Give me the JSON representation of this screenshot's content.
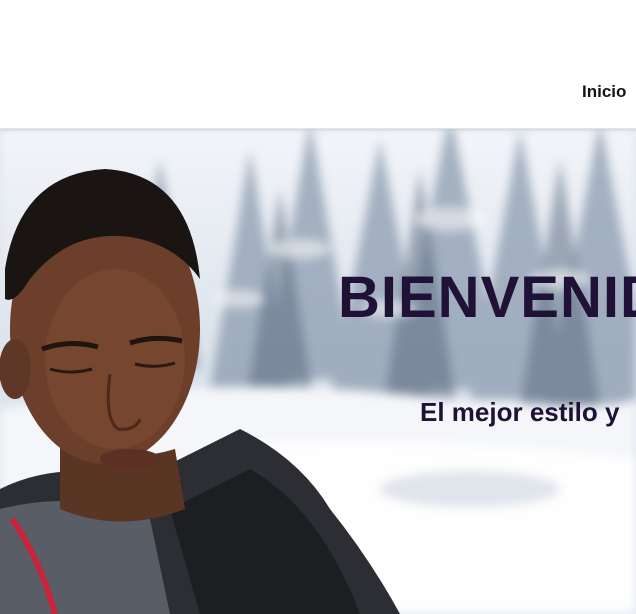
{
  "nav": {
    "home_label": "Inicio"
  },
  "hero": {
    "title": "BIENVENID",
    "subtitle": "El mejor estilo y",
    "title_color": "#1f1236"
  }
}
